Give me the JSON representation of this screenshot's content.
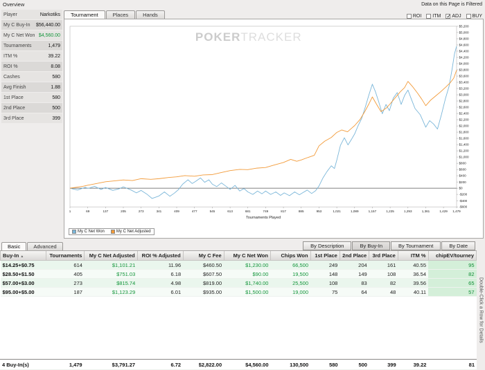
{
  "top": {
    "filtered_note": "Data on this Page is Filtered",
    "tabs": [
      "Tournament",
      "Places",
      "Hands"
    ],
    "active_tab": 0,
    "filters": [
      {
        "label": "ROI",
        "checked": false
      },
      {
        "label": "ITM",
        "checked": false
      },
      {
        "label": "ADJ",
        "checked": true
      },
      {
        "label": "BUY",
        "checked": false
      }
    ]
  },
  "sidebar": {
    "title": "Overview",
    "rows": [
      {
        "label": "Player",
        "value": "Narkotiks",
        "green": false
      },
      {
        "label": "My C Buy-In",
        "value": "$56,440.00",
        "green": false
      },
      {
        "label": "My C Net Won",
        "value": "$4,560.00",
        "green": true
      },
      {
        "label": "Tournaments",
        "value": "1,479",
        "green": false
      },
      {
        "label": "ITM %",
        "value": "39.22",
        "green": false
      },
      {
        "label": "ROI %",
        "value": "8.08",
        "green": false
      },
      {
        "label": "Cashes",
        "value": "580",
        "green": false
      },
      {
        "label": "Avg Finish",
        "value": "1.88",
        "green": false
      },
      {
        "label": "1st Place",
        "value": "580",
        "green": false
      },
      {
        "label": "2nd Place",
        "value": "500",
        "green": false
      },
      {
        "label": "3rd Place",
        "value": "399",
        "green": false
      }
    ]
  },
  "watermark": {
    "bold": "POKER",
    "light": "TRACKER"
  },
  "chart_data": {
    "type": "line",
    "title": "",
    "xlabel": "Tournaments Played",
    "ylabel": "",
    "xlim": [
      1,
      1479
    ],
    "ylim": [
      -600,
      5200
    ],
    "ytick_step": 200,
    "x_ticks": [
      1,
      69,
      137,
      205,
      273,
      341,
      409,
      477,
      545,
      613,
      681,
      749,
      817,
      885,
      953,
      1021,
      1089,
      1157,
      1225,
      1293,
      1361,
      1429,
      1479
    ],
    "grid": false,
    "legend_position": "bottom-left",
    "series": [
      {
        "name": "My C Net Won",
        "color": "#7ab6d9",
        "points": [
          [
            1,
            0
          ],
          [
            30,
            -60
          ],
          [
            60,
            30
          ],
          [
            69,
            -10
          ],
          [
            95,
            60
          ],
          [
            120,
            -40
          ],
          [
            137,
            25
          ],
          [
            165,
            -70
          ],
          [
            190,
            -15
          ],
          [
            205,
            45
          ],
          [
            235,
            -60
          ],
          [
            255,
            -150
          ],
          [
            273,
            -70
          ],
          [
            295,
            -190
          ],
          [
            315,
            -330
          ],
          [
            341,
            -250
          ],
          [
            362,
            -120
          ],
          [
            383,
            -260
          ],
          [
            400,
            -160
          ],
          [
            415,
            -50
          ],
          [
            432,
            130
          ],
          [
            452,
            270
          ],
          [
            468,
            150
          ],
          [
            480,
            210
          ],
          [
            500,
            330
          ],
          [
            516,
            190
          ],
          [
            532,
            270
          ],
          [
            545,
            130
          ],
          [
            562,
            50
          ],
          [
            580,
            170
          ],
          [
            598,
            60
          ],
          [
            613,
            -40
          ],
          [
            632,
            90
          ],
          [
            650,
            -90
          ],
          [
            666,
            -10
          ],
          [
            681,
            -120
          ],
          [
            700,
            -200
          ],
          [
            718,
            -90
          ],
          [
            735,
            -180
          ],
          [
            749,
            -90
          ],
          [
            768,
            -200
          ],
          [
            788,
            -120
          ],
          [
            806,
            -230
          ],
          [
            820,
            -150
          ],
          [
            840,
            -240
          ],
          [
            860,
            -120
          ],
          [
            878,
            -210
          ],
          [
            892,
            -140
          ],
          [
            908,
            -60
          ],
          [
            925,
            -170
          ],
          [
            940,
            -80
          ],
          [
            953,
            70
          ],
          [
            968,
            330
          ],
          [
            984,
            540
          ],
          [
            1000,
            720
          ],
          [
            1012,
            630
          ],
          [
            1021,
            900
          ],
          [
            1035,
            1380
          ],
          [
            1050,
            1620
          ],
          [
            1064,
            1390
          ],
          [
            1078,
            1580
          ],
          [
            1089,
            1740
          ],
          [
            1102,
            2000
          ],
          [
            1116,
            2240
          ],
          [
            1130,
            2600
          ],
          [
            1144,
            3000
          ],
          [
            1157,
            3340
          ],
          [
            1169,
            3090
          ],
          [
            1181,
            2780
          ],
          [
            1195,
            2390
          ],
          [
            1209,
            2690
          ],
          [
            1222,
            2490
          ],
          [
            1237,
            2890
          ],
          [
            1252,
            3070
          ],
          [
            1267,
            2690
          ],
          [
            1281,
            2990
          ],
          [
            1293,
            3150
          ],
          [
            1306,
            2860
          ],
          [
            1320,
            2560
          ],
          [
            1340,
            2360
          ],
          [
            1361,
            1960
          ],
          [
            1376,
            2170
          ],
          [
            1391,
            2060
          ],
          [
            1406,
            1900
          ],
          [
            1421,
            2360
          ],
          [
            1436,
            2870
          ],
          [
            1450,
            3270
          ],
          [
            1461,
            3780
          ],
          [
            1471,
            4320
          ],
          [
            1479,
            4560
          ]
        ]
      },
      {
        "name": "My C Net Adjusted",
        "color": "#f29a38",
        "points": [
          [
            1,
            0
          ],
          [
            50,
            60
          ],
          [
            69,
            95
          ],
          [
            100,
            145
          ],
          [
            137,
            205
          ],
          [
            170,
            235
          ],
          [
            205,
            265
          ],
          [
            240,
            245
          ],
          [
            273,
            305
          ],
          [
            310,
            285
          ],
          [
            341,
            305
          ],
          [
            380,
            345
          ],
          [
            409,
            365
          ],
          [
            440,
            405
          ],
          [
            477,
            385
          ],
          [
            510,
            425
          ],
          [
            545,
            435
          ],
          [
            580,
            505
          ],
          [
            613,
            565
          ],
          [
            650,
            605
          ],
          [
            681,
            595
          ],
          [
            715,
            645
          ],
          [
            749,
            665
          ],
          [
            782,
            745
          ],
          [
            817,
            825
          ],
          [
            845,
            925
          ],
          [
            868,
            865
          ],
          [
            885,
            905
          ],
          [
            910,
            985
          ],
          [
            935,
            1055
          ],
          [
            953,
            1360
          ],
          [
            975,
            1510
          ],
          [
            1000,
            1630
          ],
          [
            1021,
            1790
          ],
          [
            1040,
            1870
          ],
          [
            1062,
            1810
          ],
          [
            1089,
            2010
          ],
          [
            1110,
            2210
          ],
          [
            1128,
            2460
          ],
          [
            1144,
            2710
          ],
          [
            1157,
            2930
          ],
          [
            1172,
            2710
          ],
          [
            1190,
            2460
          ],
          [
            1210,
            2570
          ],
          [
            1225,
            2710
          ],
          [
            1245,
            2910
          ],
          [
            1263,
            3090
          ],
          [
            1280,
            3230
          ],
          [
            1293,
            3430
          ],
          [
            1310,
            3270
          ],
          [
            1330,
            3050
          ],
          [
            1345,
            2870
          ],
          [
            1361,
            2650
          ],
          [
            1380,
            2830
          ],
          [
            1400,
            2970
          ],
          [
            1420,
            3110
          ],
          [
            1438,
            3250
          ],
          [
            1455,
            3390
          ],
          [
            1468,
            3530
          ],
          [
            1479,
            3791
          ]
        ]
      }
    ]
  },
  "bottom": {
    "tabs": [
      "Basic",
      "Advanced"
    ],
    "active_tab": 0,
    "by_buttons": [
      "By Description",
      "By Buy-In",
      "By Tournament",
      "By Date"
    ],
    "active_by": 1,
    "side_note": "Double-Click a Row for Details",
    "table": {
      "sort_icon": "▲",
      "columns": [
        "Buy-In",
        "Tournaments",
        "My C Net Adjusted",
        "ROI % Adjusted",
        "My C Fee",
        "My C Net Won",
        "Chips Won",
        "1st Place",
        "2nd Place",
        "3rd Place",
        "ITM %",
        "chipEV/tourney"
      ],
      "green_cols": [
        2,
        5,
        6,
        11
      ],
      "chipev_col": 11,
      "rows": [
        [
          "$14.25+$0.75",
          "614",
          "$1,101.21",
          "11.96",
          "$460.50",
          "$1,230.00",
          "66,500",
          "249",
          "204",
          "161",
          "40.55",
          "95"
        ],
        [
          "$28.50+$1.50",
          "405",
          "$751.03",
          "6.18",
          "$607.50",
          "$90.00",
          "19,500",
          "148",
          "149",
          "108",
          "36.54",
          "82"
        ],
        [
          "$57.00+$3.00",
          "273",
          "$815.74",
          "4.98",
          "$819.00",
          "$1,740.00",
          "25,500",
          "108",
          "83",
          "82",
          "39.56",
          "65"
        ],
        [
          "$95.00+$5.00",
          "187",
          "$1,123.29",
          "6.01",
          "$935.00",
          "$1,500.00",
          "19,000",
          "75",
          "64",
          "48",
          "40.11",
          "57"
        ]
      ],
      "footer": [
        "4 Buy-In(s)",
        "1,479",
        "$3,791.27",
        "6.72",
        "$2,822.00",
        "$4,560.00",
        "130,500",
        "580",
        "500",
        "399",
        "39.22",
        "81"
      ]
    }
  }
}
